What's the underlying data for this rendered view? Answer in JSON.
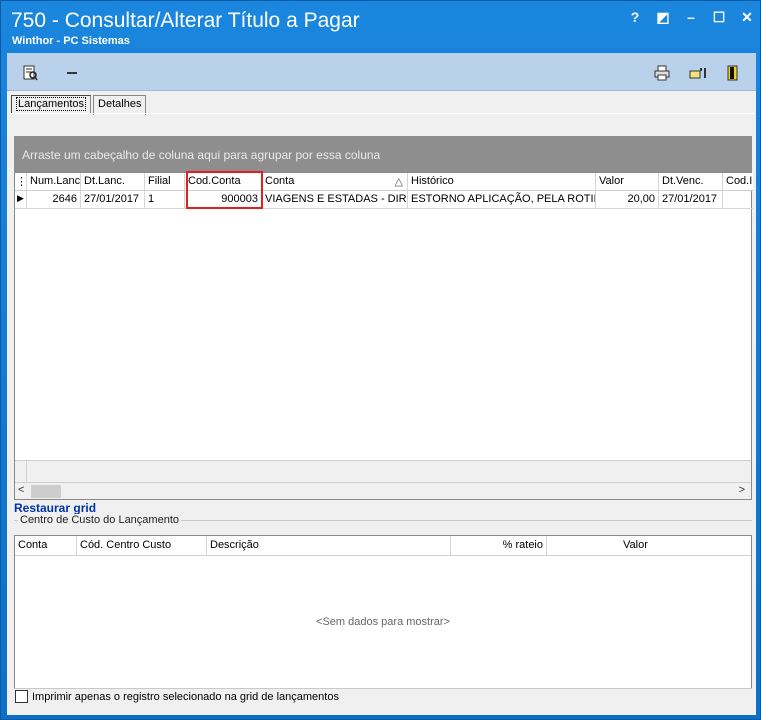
{
  "window": {
    "title": "750 - Consultar/Alterar Título a Pagar",
    "subtitle": "Winthor - PC Sistemas",
    "controls": {
      "help": "?",
      "restore": "◩",
      "minimize": "–",
      "maximize": "☐",
      "close": "✕"
    }
  },
  "toolbar": {
    "icons": [
      "document-search-icon",
      "minus-icon",
      "printer-icon",
      "hand-pointer-icon",
      "exit-door-icon"
    ]
  },
  "tabs": [
    {
      "label": "Lançamentos",
      "active": true
    },
    {
      "label": "Detalhes",
      "active": false
    }
  ],
  "grid": {
    "group_hint": "Arraste um cabeçalho de coluna aqui para agrupar por essa coluna",
    "columns": [
      "Num.Lanc.",
      "Dt.Lanc.",
      "Filial",
      "Cod.Conta",
      "Conta",
      "Histórico",
      "Valor",
      "Dt.Venc.",
      "Cod.I"
    ],
    "sort_indicator": "△",
    "rows": [
      {
        "num_lanc": "2646",
        "dt_lanc": "27/01/2017",
        "filial": "1",
        "cod_conta": "900003",
        "conta": "VIAGENS E ESTADAS - DIRETO",
        "historico": "ESTORNO APLICAÇÃO, PELA ROTINA",
        "valor": "20,00",
        "dt_venc": "27/01/2017",
        "cod_i": ""
      }
    ],
    "highlight_column": "Cod.Conta"
  },
  "restore_grid_label": "Restaurar grid",
  "cost_center": {
    "legend": "Centro de Custo do Lançamento",
    "columns": [
      "Conta",
      "Cód. Centro Custo",
      "Descrição",
      "% rateio",
      "Valor"
    ],
    "empty_text": "<Sem dados para mostrar>"
  },
  "footer": {
    "checkbox_label": "Imprimir apenas o registro selecionado na grid de lançamentos",
    "checked": false
  }
}
